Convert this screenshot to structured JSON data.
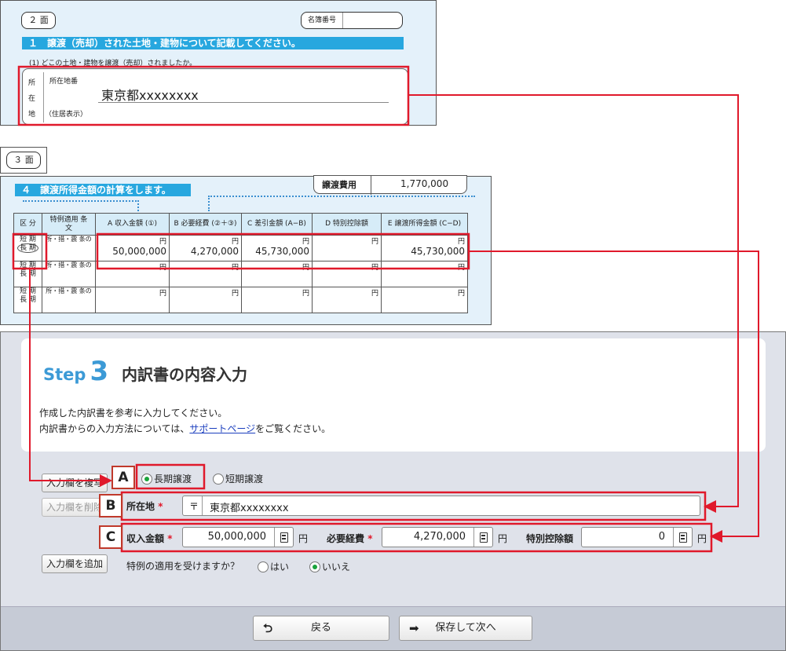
{
  "form2": {
    "page_label": "２ 面",
    "name_number_label": "名簿番号",
    "section_title": "１　譲渡（売却）された土地・建物について記載してください。",
    "question": "(1) どこの土地・建物を譲渡（売却）されましたか。",
    "loc_chars": [
      "所",
      "在",
      "地"
    ],
    "lot_number_label": "所在地番",
    "address_value": "東京都xxxxxxxx",
    "residence_label": "（住居表示）"
  },
  "form3": {
    "page_label": "３ 面",
    "section_title": "４　譲渡所得金額の計算をします。",
    "transfer_cost_label": "譲渡費用",
    "transfer_cost_value": "1,770,000",
    "headers": [
      "区 分",
      "特例適用 条　文",
      "A 収入金額 (①)",
      "B 必要経費 (②＋③)",
      "C 差引金額 (A−B)",
      "D 特別控除額",
      "E 譲渡所得金額 (C−D)"
    ],
    "kubun_short": "短 期",
    "kubun_long": "長 期",
    "tokurei_text": "所・措・震 条の",
    "yen": "円",
    "row1": [
      "50,000,000",
      "4,270,000",
      "45,730,000",
      "",
      "45,730,000"
    ]
  },
  "step": {
    "word": "Step",
    "number": "3",
    "title": "内訳書の内容入力",
    "line1": "作成した内訳書を参考に入力してください。",
    "line2_pre": "内訳書からの入力方法については、",
    "line2_link": "サポートページ",
    "line2_post": "をご覧ください。"
  },
  "form": {
    "copy_btn": "入力欄を複写",
    "delete_btn": "入力欄を削除",
    "add_btn": "入力欄を追加",
    "radio_long": "長期譲渡",
    "radio_short": "短期譲渡",
    "selected_term": "長期譲渡",
    "location_label": "所在地",
    "postal_mark": "〒",
    "location_value": "東京都xxxxxxxx",
    "income_label": "収入金額",
    "income_value": "50,000,000",
    "expense_label": "必要経費",
    "expense_value": "4,270,000",
    "deduction_label": "特別控除額",
    "deduction_value": "0",
    "yen": "円",
    "req": "*",
    "special_question": "特例の適用を受けますか？",
    "yes": "はい",
    "no": "いいえ",
    "special_selected": "いいえ"
  },
  "markers": {
    "a": "A",
    "b": "B",
    "c": "C"
  },
  "footer": {
    "back": "戻る",
    "save_next": "保存して次へ"
  },
  "colors": {
    "accent": "#3c9ad6",
    "highlight": "#e0192b",
    "form_bg": "#e4f1fa",
    "radio_on": "#1aa33b"
  }
}
